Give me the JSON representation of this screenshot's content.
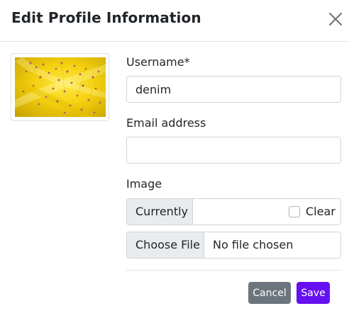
{
  "modal": {
    "title": "Edit Profile Information",
    "close_icon": "close-icon"
  },
  "profile_image": {
    "icon": "image-thumbnail"
  },
  "form": {
    "username": {
      "label": "Username*",
      "value": "denim"
    },
    "email": {
      "label": "Email address",
      "value": ""
    },
    "image": {
      "label": "Image",
      "currently_label": "Currently",
      "clear_label": "Clear",
      "clear_checked": false,
      "choose_file_label": "Choose File",
      "file_status": "No file chosen"
    }
  },
  "actions": {
    "cancel_label": "Cancel",
    "save_label": "Save"
  },
  "colors": {
    "save_button": "#6610f2",
    "cancel_button": "#6c757d",
    "addon_background": "#e9ecef",
    "border": "#ced4da"
  }
}
